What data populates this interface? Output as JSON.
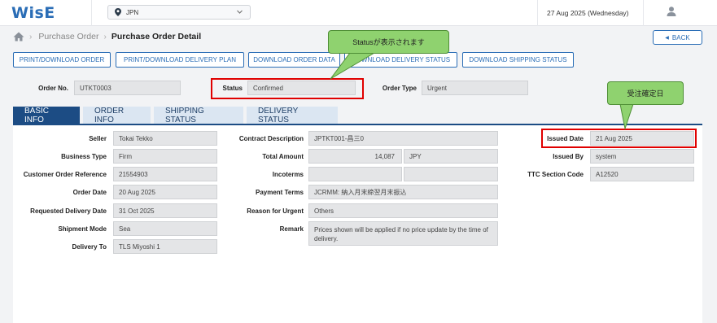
{
  "header": {
    "logo": "WisE",
    "country": "JPN",
    "date": "27 Aug 2025 (Wednesday)"
  },
  "breadcrumb": {
    "parent": "Purchase Order",
    "current": "Purchase Order Detail"
  },
  "back_label": "BACK",
  "actions": [
    "PRINT/DOWNLOAD ORDER",
    "PRINT/DOWNLOAD DELIVERY PLAN",
    "DOWNLOAD ORDER DATA",
    "DOWNLOAD DELIVERY STATUS",
    "DOWNLOAD SHIPPING STATUS"
  ],
  "summary": {
    "order_no_label": "Order No.",
    "order_no": "UTKT0003",
    "status_label": "Status",
    "status": "Confirmed",
    "order_type_label": "Order Type",
    "order_type": "Urgent"
  },
  "tabs": [
    "BASIC INFO",
    "ORDER INFO",
    "SHIPPING STATUS",
    "DELIVERY STATUS"
  ],
  "basic": {
    "seller_label": "Seller",
    "seller": "Tokai Tekko",
    "business_type_label": "Business Type",
    "business_type": "Firm",
    "customer_ref_label": "Customer Order Reference",
    "customer_ref": "21554903",
    "order_date_label": "Order Date",
    "order_date": "20 Aug 2025",
    "req_delivery_label": "Requested Delivery Date",
    "req_delivery": "31 Oct 2025",
    "shipment_mode_label": "Shipment Mode",
    "shipment_mode": "Sea",
    "delivery_to_label": "Delivery To",
    "delivery_to": "TLS Miyoshi 1",
    "contract_desc_label": "Contract Description",
    "contract_desc": "JPTKT001-昌三0",
    "total_amount_label": "Total Amount",
    "total_amount": "14,087",
    "currency": "JPY",
    "incoterms_label": "Incoterms",
    "payment_terms_label": "Payment Terms",
    "payment_terms": "JCRMM: 納入月末締翌月末振込",
    "reason_urgent_label": "Reason for Urgent",
    "reason_urgent": "Others",
    "remark_label": "Remark",
    "remark": "Prices shown will be applied if no price update by the time of delivery.",
    "issued_date_label": "Issued Date",
    "issued_date": "21 Aug 2025",
    "issued_by_label": "Issued By",
    "issued_by": "system",
    "ttc_section_label": "TTC Section Code",
    "ttc_section": "A12520"
  },
  "callouts": {
    "status_note": "Statusが表示されます",
    "issued_note": "受注確定日"
  },
  "colors": {
    "brand": "#2a6db6",
    "tab_active": "#1c4c84",
    "highlight": "#e00000",
    "callout": "#8fd26f"
  }
}
